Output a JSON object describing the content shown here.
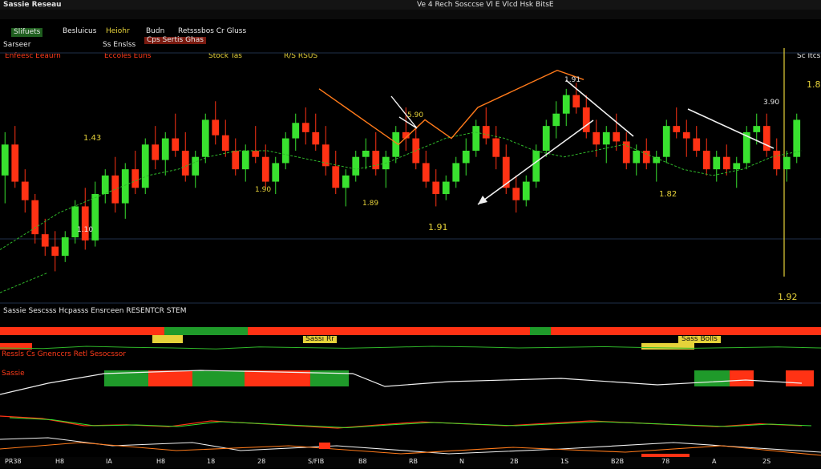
{
  "window": {
    "title": "Sassie Reseau",
    "title_right": "Ve 4 Rech Sosccse Vl E Vlcd Hsk BitsE"
  },
  "legend": {
    "row1": [
      "Slifuets",
      "Besluicus",
      "Heiohr",
      "Budn",
      "Retsssbos Cr Gluss",
      "Cps Sertis Ghas"
    ],
    "row2": [
      "Sarseer",
      "Ss Enslss"
    ],
    "row3": [
      "Enfeesc Eeaurn",
      "Eccoles Euns",
      "Stock Tas"
    ]
  },
  "annotations": {
    "price_left": "1.43",
    "price_c2": "1.10",
    "price_mid": "1.90",
    "price_mid2": "1.89",
    "price_low": "1.91",
    "price_center": "5.90",
    "price_right": "1.82",
    "price_right2": "3.90",
    "price_right_top": "1.82",
    "right_axis_value": "1.92",
    "header_right": "Sc Itcs",
    "header_mid": "R/S RSUS",
    "peak_label": "1.91"
  },
  "indicator_panels": {
    "panel1_title": "Sassie Sescsss Hcpasss Ensrceen RESENTCR STEM",
    "panel1_badge": "Sass Bolls",
    "panel1_badge_mid": "Sassi Rr",
    "panel2_title": "Ressls Cs Gnenccrs Retl Sesocssor",
    "panel3_title": "Sassie"
  },
  "colors": {
    "background": "#000000",
    "bull": "#39e12f",
    "bear": "#ff3214",
    "accent_orange": "#ff7a1a",
    "accent_yellow": "#e6d23a",
    "trend_white": "#f0f0f0",
    "ma_green": "#2fb82a",
    "grid": "#20304a"
  },
  "x_axis_labels": [
    "PR38",
    "H8",
    "IA",
    "H8",
    "18",
    "28",
    "S/FIB",
    "B8",
    "RB",
    "N",
    "2B",
    "1S",
    "B2B",
    "78",
    "A",
    "2S"
  ],
  "chart_data": {
    "type": "candlestick",
    "title": "",
    "ohlc": [
      [
        1.64,
        1.78,
        1.55,
        1.74
      ],
      [
        1.74,
        1.8,
        1.6,
        1.62
      ],
      [
        1.62,
        1.66,
        1.52,
        1.56
      ],
      [
        1.56,
        1.58,
        1.42,
        1.45
      ],
      [
        1.45,
        1.5,
        1.38,
        1.41
      ],
      [
        1.41,
        1.46,
        1.33,
        1.38
      ],
      [
        1.38,
        1.46,
        1.36,
        1.44
      ],
      [
        1.44,
        1.56,
        1.42,
        1.54
      ],
      [
        1.54,
        1.6,
        1.4,
        1.43
      ],
      [
        1.43,
        1.62,
        1.41,
        1.58
      ],
      [
        1.58,
        1.66,
        1.55,
        1.64
      ],
      [
        1.64,
        1.7,
        1.52,
        1.55
      ],
      [
        1.55,
        1.68,
        1.5,
        1.66
      ],
      [
        1.66,
        1.72,
        1.58,
        1.6
      ],
      [
        1.6,
        1.76,
        1.58,
        1.74
      ],
      [
        1.74,
        1.8,
        1.66,
        1.69
      ],
      [
        1.69,
        1.78,
        1.64,
        1.76
      ],
      [
        1.76,
        1.84,
        1.7,
        1.72
      ],
      [
        1.72,
        1.78,
        1.62,
        1.64
      ],
      [
        1.64,
        1.72,
        1.6,
        1.7
      ],
      [
        1.7,
        1.84,
        1.68,
        1.82
      ],
      [
        1.82,
        1.88,
        1.74,
        1.77
      ],
      [
        1.77,
        1.82,
        1.7,
        1.72
      ],
      [
        1.72,
        1.76,
        1.64,
        1.66
      ],
      [
        1.66,
        1.74,
        1.62,
        1.72
      ],
      [
        1.72,
        1.8,
        1.68,
        1.7
      ],
      [
        1.7,
        1.74,
        1.6,
        1.62
      ],
      [
        1.62,
        1.7,
        1.58,
        1.68
      ],
      [
        1.68,
        1.78,
        1.66,
        1.76
      ],
      [
        1.76,
        1.84,
        1.72,
        1.81
      ],
      [
        1.81,
        1.86,
        1.74,
        1.78
      ],
      [
        1.78,
        1.84,
        1.72,
        1.74
      ],
      [
        1.74,
        1.8,
        1.64,
        1.67
      ],
      [
        1.67,
        1.72,
        1.58,
        1.6
      ],
      [
        1.6,
        1.66,
        1.54,
        1.64
      ],
      [
        1.64,
        1.72,
        1.62,
        1.7
      ],
      [
        1.7,
        1.76,
        1.66,
        1.72
      ],
      [
        1.72,
        1.78,
        1.64,
        1.66
      ],
      [
        1.66,
        1.72,
        1.6,
        1.7
      ],
      [
        1.7,
        1.8,
        1.68,
        1.78
      ],
      [
        1.78,
        1.86,
        1.72,
        1.76
      ],
      [
        1.76,
        1.8,
        1.66,
        1.68
      ],
      [
        1.68,
        1.72,
        1.6,
        1.62
      ],
      [
        1.62,
        1.66,
        1.54,
        1.58
      ],
      [
        1.58,
        1.64,
        1.56,
        1.62
      ],
      [
        1.62,
        1.7,
        1.6,
        1.68
      ],
      [
        1.68,
        1.76,
        1.64,
        1.72
      ],
      [
        1.72,
        1.82,
        1.7,
        1.8
      ],
      [
        1.8,
        1.86,
        1.74,
        1.76
      ],
      [
        1.76,
        1.8,
        1.66,
        1.7
      ],
      [
        1.7,
        1.74,
        1.58,
        1.6
      ],
      [
        1.6,
        1.64,
        1.52,
        1.56
      ],
      [
        1.56,
        1.64,
        1.54,
        1.62
      ],
      [
        1.62,
        1.74,
        1.6,
        1.72
      ],
      [
        1.72,
        1.82,
        1.7,
        1.8
      ],
      [
        1.8,
        1.88,
        1.76,
        1.84
      ],
      [
        1.84,
        1.92,
        1.8,
        1.9
      ],
      [
        1.9,
        1.94,
        1.84,
        1.86
      ],
      [
        1.86,
        1.9,
        1.76,
        1.78
      ],
      [
        1.78,
        1.82,
        1.7,
        1.74
      ],
      [
        1.74,
        1.8,
        1.68,
        1.78
      ],
      [
        1.78,
        1.84,
        1.72,
        1.75
      ],
      [
        1.75,
        1.78,
        1.66,
        1.68
      ],
      [
        1.68,
        1.74,
        1.64,
        1.72
      ],
      [
        1.72,
        1.76,
        1.66,
        1.68
      ],
      [
        1.68,
        1.72,
        1.62,
        1.7
      ],
      [
        1.7,
        1.82,
        1.68,
        1.8
      ],
      [
        1.8,
        1.86,
        1.76,
        1.78
      ],
      [
        1.78,
        1.82,
        1.7,
        1.76
      ],
      [
        1.76,
        1.8,
        1.7,
        1.72
      ],
      [
        1.72,
        1.76,
        1.64,
        1.66
      ],
      [
        1.66,
        1.72,
        1.62,
        1.7
      ],
      [
        1.7,
        1.74,
        1.64,
        1.66
      ],
      [
        1.66,
        1.7,
        1.6,
        1.68
      ],
      [
        1.68,
        1.8,
        1.66,
        1.78
      ],
      [
        1.78,
        1.84,
        1.74,
        1.8
      ],
      [
        1.8,
        1.84,
        1.7,
        1.72
      ],
      [
        1.72,
        1.76,
        1.64,
        1.66
      ],
      [
        1.66,
        1.72,
        1.62,
        1.7
      ],
      [
        1.7,
        1.84,
        1.68,
        1.82
      ]
    ],
    "ylim": [
      1.3,
      2.0
    ],
    "ma_line": [
      1.4,
      1.46,
      1.52,
      1.56,
      1.6,
      1.64,
      1.66,
      1.7,
      1.72,
      1.72,
      1.7,
      1.68,
      1.66,
      1.68,
      1.72,
      1.76,
      1.78,
      1.76,
      1.72,
      1.7,
      1.72,
      1.74,
      1.7,
      1.66,
      1.64,
      1.66,
      1.7,
      1.72
    ],
    "orange_line": [
      1.92,
      1.86,
      1.8,
      1.74,
      1.82,
      1.76,
      1.86,
      1.9,
      1.94,
      1.98,
      1.95
    ],
    "indicator1": [
      0.5,
      0.48,
      0.55,
      0.52,
      0.5,
      0.47,
      0.53,
      0.51,
      0.49,
      0.52,
      0.55,
      0.53,
      0.5,
      0.52,
      0.54,
      0.51,
      0.49,
      0.51,
      0.53,
      0.5
    ],
    "indicator2": [
      0.6,
      0.55,
      0.4,
      0.42,
      0.38,
      0.5,
      0.45,
      0.4,
      0.35,
      0.42,
      0.48,
      0.44,
      0.4,
      0.45,
      0.5,
      0.46,
      0.42,
      0.38,
      0.44,
      0.4
    ]
  }
}
